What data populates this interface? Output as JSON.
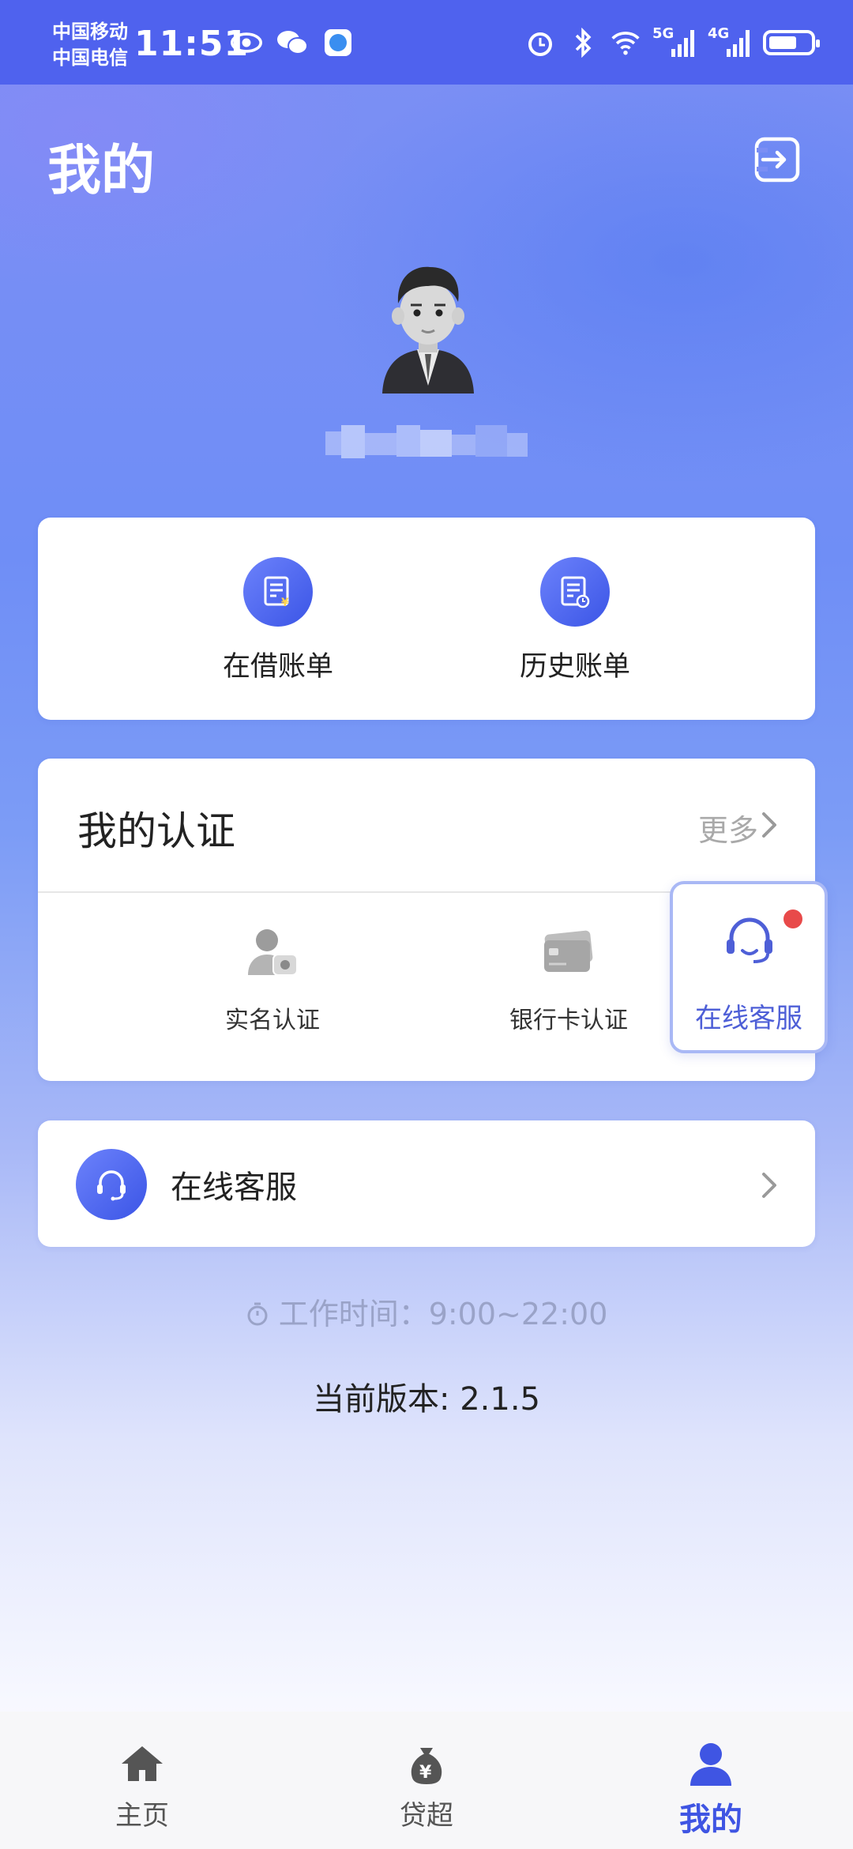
{
  "status_bar": {
    "carrier1": "中国移动",
    "carrier2": "中国电信",
    "time": "11:51",
    "network1": "5G",
    "network2": "4G"
  },
  "header": {
    "title": "我的"
  },
  "bills": {
    "items": [
      {
        "label": "在借账单",
        "icon": "bill-yuan-icon"
      },
      {
        "label": "历史账单",
        "icon": "bill-history-icon"
      }
    ]
  },
  "certification": {
    "title": "我的认证",
    "more": "更多",
    "items": [
      {
        "label": "实名认证",
        "icon": "person-id-icon"
      },
      {
        "label": "银行卡认证",
        "icon": "bank-card-icon"
      }
    ]
  },
  "floating_service": {
    "label": "在线客服"
  },
  "customer_service": {
    "label": "在线客服"
  },
  "work_hours": "工作时间：9:00~22:00",
  "version": "当前版本: 2.1.5",
  "tabs": [
    {
      "label": "主页",
      "icon": "home-icon"
    },
    {
      "label": "贷超",
      "icon": "money-bag-icon"
    },
    {
      "label": "我的",
      "icon": "user-icon",
      "active": true
    }
  ],
  "colors": {
    "primary": "#3f55e3",
    "status_bar": "#4f62ee",
    "badge_red": "#e84a4a"
  }
}
